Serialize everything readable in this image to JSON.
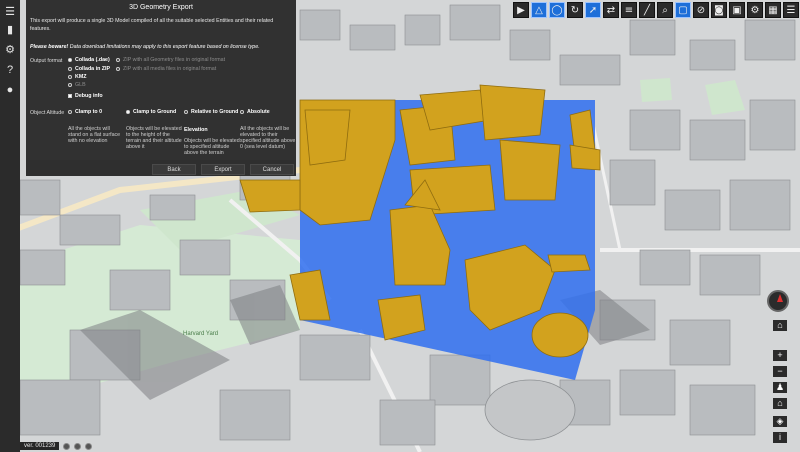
{
  "dialog": {
    "title": "3D Geometry Export",
    "intro": "This export will produce a single 3D Model compiled of all the suitable selected Entities and their related features.",
    "warning_strong": "Please beware!",
    "warning_text": " Data download limitations may apply to this export feature based on license type.",
    "output_format_label": "Output format",
    "formats": [
      {
        "label": "Collada (.dae)",
        "selected": true,
        "dim": false
      },
      {
        "label": "Collada in ZIP",
        "selected": false,
        "dim": false
      },
      {
        "label": "KMZ",
        "selected": false,
        "dim": false
      },
      {
        "label": "GLB",
        "selected": false,
        "dim": true
      }
    ],
    "zip_options": [
      {
        "label": "ZIP with all Geometry files in original format"
      },
      {
        "label": "ZIP with all media files in original format"
      }
    ],
    "debug_label": "Debug info",
    "object_altitude_label": "Object Altitude",
    "altitude_options": [
      {
        "label": "Clamp to 0",
        "selected": false,
        "note": "All the objects will stand on a flat surface with no elevation"
      },
      {
        "label": "Clamp to Ground",
        "selected": true,
        "note": "Objects will be elevated to the height of the terrain and their altitude above it"
      },
      {
        "label": "Relative to Ground",
        "selected": false,
        "heading": "Elevation",
        "note": "Objects will be elevated to specified altitude above the terrain"
      },
      {
        "label": "Absolute",
        "selected": false,
        "note": "All the objects will be elevated to their specified altitude above 0 (sea level datum)"
      }
    ],
    "buttons": {
      "back": "Back",
      "export": "Export",
      "cancel": "Cancel"
    }
  },
  "map_labels": {
    "district": "Harvard Yard"
  },
  "status": {
    "version": "ver. 001239"
  },
  "toolbar_icons": [
    "play-icon",
    "triangle-icon",
    "circle-icon",
    "refresh-icon",
    "cursor-icon",
    "swap-icon",
    "layers-icon",
    "search-icon",
    "frame-icon",
    "ruler-icon",
    "no-icon",
    "camera-icon",
    "image-icon",
    "gear-icon",
    "grid-icon",
    "menu-icon"
  ],
  "colors": {
    "selection_blue": "#2f6ff0",
    "building_gold": "#d2a21e",
    "ui_dark": "#2b2b2b"
  }
}
